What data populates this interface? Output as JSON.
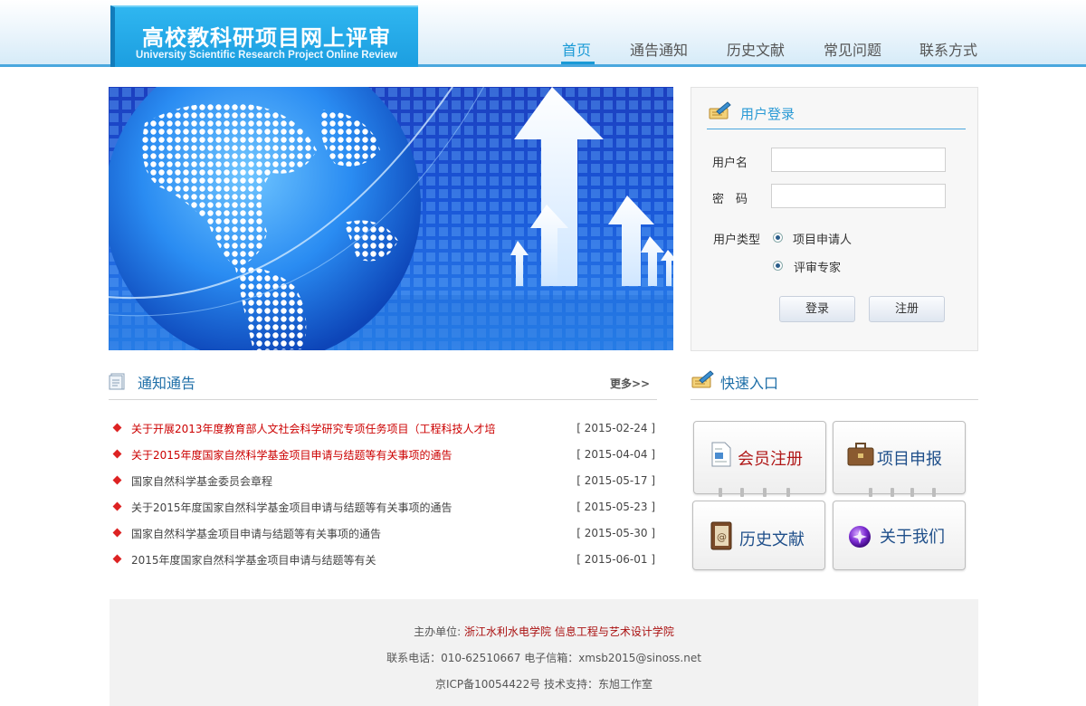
{
  "site": {
    "title_cn": "高校教科研项目网上评审",
    "title_en": "University Scientific Research Project Online Review"
  },
  "nav": {
    "items": [
      "首页",
      "通告通知",
      "历史文献",
      "常见问题",
      "联系方式"
    ],
    "active_index": 0
  },
  "login": {
    "title": "用户登录",
    "username_label": "用户名",
    "password_label": "密　码",
    "username_value": "",
    "password_value": "",
    "user_type_label": "用户类型",
    "user_types": [
      "项目申请人",
      "评审专家"
    ],
    "login_button": "登录",
    "register_button": "注册"
  },
  "notices": {
    "title": "通知通告",
    "more": "更多>>",
    "items": [
      {
        "text": "关于开展2013年度教育部人文社会科学研究专项任务项目（工程科技人才培",
        "date": "[ 2015-02-24 ]",
        "highlight": true
      },
      {
        "text": "关于2015年度国家自然科学基金项目申请与结题等有关事项的通告",
        "date": "[ 2015-04-04 ]",
        "highlight": true
      },
      {
        "text": "国家自然科学基金委员会章程",
        "date": "[ 2015-05-17 ]",
        "highlight": false
      },
      {
        "text": "关于2015年度国家自然科学基金项目申请与结题等有关事项的通告",
        "date": "[ 2015-05-23 ]",
        "highlight": false
      },
      {
        "text": "国家自然科学基金项目申请与结题等有关事项的通告",
        "date": "[ 2015-05-30 ]",
        "highlight": false
      },
      {
        "text": "2015年度国家自然科学基金项目申请与结题等有关",
        "date": "[ 2015-06-01 ]",
        "highlight": false
      }
    ]
  },
  "quick": {
    "title": "快速入口",
    "items": [
      {
        "label": "会员注册",
        "icon": "document-icon",
        "color": "#b01818"
      },
      {
        "label": "项目申报",
        "icon": "briefcase-icon",
        "color": "#1f4f8a"
      },
      {
        "label": "历史文献",
        "icon": "address-book-icon",
        "color": "#1f4f8a"
      },
      {
        "label": "关于我们",
        "icon": "purple-orb-icon",
        "color": "#1f4f8a"
      }
    ]
  },
  "footer": {
    "sponsor_label": "主办单位:",
    "sponsor_names": "浙江水利水电学院  信息工程与艺术设计学院",
    "contact": "联系电话：010-62510667 电子信箱：xmsb2015@sinoss.net",
    "icp": "京ICP备10054422号  技术支持：东旭工作室"
  },
  "colors": {
    "accent": "#1a9ad6",
    "notice_red": "#cc0000",
    "dot_red": "#dd2222",
    "title_blue": "#1f6fa8"
  }
}
